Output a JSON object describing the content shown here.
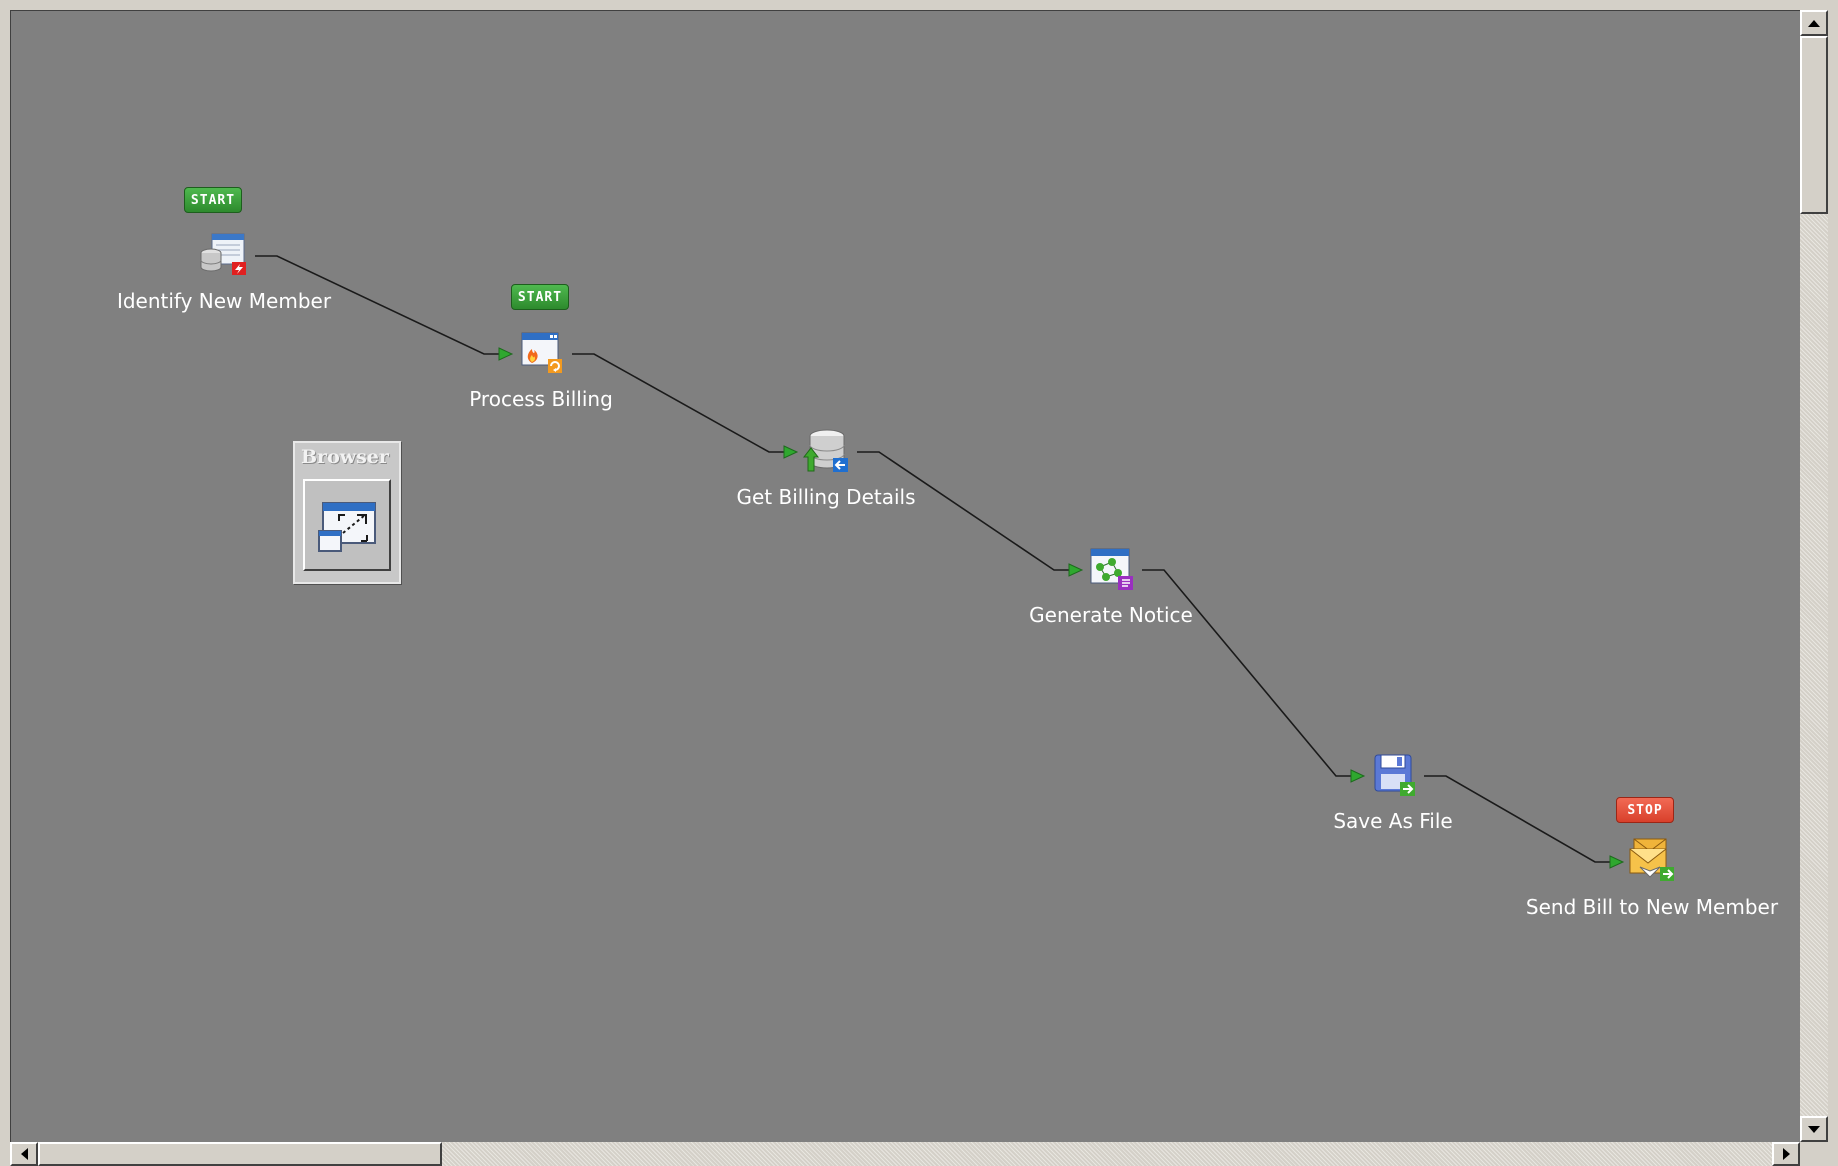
{
  "nodes": [
    {
      "id": "identify-new-member",
      "label": "Identify New Member",
      "icon": "database-table-trigger-icon",
      "badge": "START"
    },
    {
      "id": "process-billing",
      "label": "Process Billing",
      "icon": "window-process-icon",
      "badge": "START"
    },
    {
      "id": "get-billing-details",
      "label": "Get Billing Details",
      "icon": "database-query-icon",
      "badge": ""
    },
    {
      "id": "generate-notice",
      "label": "Generate Notice",
      "icon": "window-transform-icon",
      "badge": ""
    },
    {
      "id": "save-as-file",
      "label": "Save As File",
      "icon": "floppy-save-icon",
      "badge": ""
    },
    {
      "id": "send-bill-to-new-member",
      "label": "Send Bill to New Member",
      "icon": "email-send-icon",
      "badge": "STOP"
    }
  ],
  "connections": [
    {
      "from": "identify-new-member",
      "to": "process-billing"
    },
    {
      "from": "process-billing",
      "to": "get-billing-details"
    },
    {
      "from": "get-billing-details",
      "to": "generate-notice"
    },
    {
      "from": "generate-notice",
      "to": "save-as-file"
    },
    {
      "from": "save-as-file",
      "to": "send-bill-to-new-member"
    }
  ],
  "browser_widget": {
    "title": "Browser",
    "icon": "expand-window-icon"
  },
  "colors": {
    "canvas": "#808080",
    "wire": "#1a1a1a",
    "arrow": "#2fa82f",
    "start_badge": "#3a9e3a",
    "stop_badge": "#e24c36",
    "label_text": "#ffffff"
  }
}
